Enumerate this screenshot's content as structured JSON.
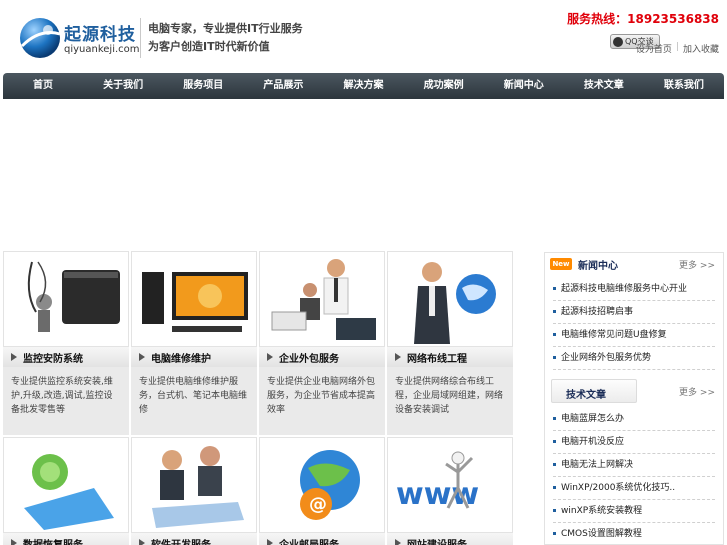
{
  "header": {
    "logo_name": "起源科技",
    "logo_sub": "qiyuankeji.com",
    "slogan1": "电脑专家，专业提供IT行业服务",
    "slogan2": "为客户创造IT时代新价值",
    "hotline": "服务热线：18923536838",
    "qq_label": "QQ交谈",
    "links": [
      "设为首页",
      "加入收藏"
    ]
  },
  "nav": [
    "首页",
    "关于我们",
    "服务项目",
    "产品展示",
    "解决方案",
    "成功案例",
    "新闻中心",
    "技术文章",
    "联系我们"
  ],
  "products": [
    {
      "title": "监控安防系统",
      "desc": "专业提供监控系统安装,维护,升级,改造,调试,监控设备批发零售等"
    },
    {
      "title": "电脑维修维护",
      "desc": "专业提供电脑维修维护服务，台式机、笔记本电脑维修"
    },
    {
      "title": "企业外包服务",
      "desc": "专业提供企业电脑网络外包服务，为企业节省成本提高效率"
    },
    {
      "title": "网络布线工程",
      "desc": "专业提供网络综合布线工程，企业局域网组建，网络设备安装调试"
    },
    {
      "title": "数据恢复服务",
      "desc": ""
    },
    {
      "title": "软件开发服务",
      "desc": ""
    },
    {
      "title": "企业邮局服务",
      "desc": ""
    },
    {
      "title": "网站建设服务",
      "desc": ""
    }
  ],
  "sidebar": {
    "news_badge": "New",
    "news_title": "新闻中心",
    "more_label": "更多 >>",
    "news_items": [
      "起源科技电脑维修服务中心开业",
      "起源科技招聘启事",
      "电脑维修常见问题U盘修复",
      "企业网络外包服务优势"
    ],
    "tech_title": "技术文章",
    "tech_items": [
      "电脑蓝屏怎么办",
      "电脑开机没反应",
      "电脑无法上网解决",
      "WinXP/2000系统优化技巧..",
      "winXP系统安装教程",
      "CMOS设置图解教程"
    ]
  },
  "colors": {
    "brand": "#1f5f9e",
    "nav_bg": "#3a444c",
    "hotline": "#e0000a",
    "badge": "#ff8a00"
  }
}
